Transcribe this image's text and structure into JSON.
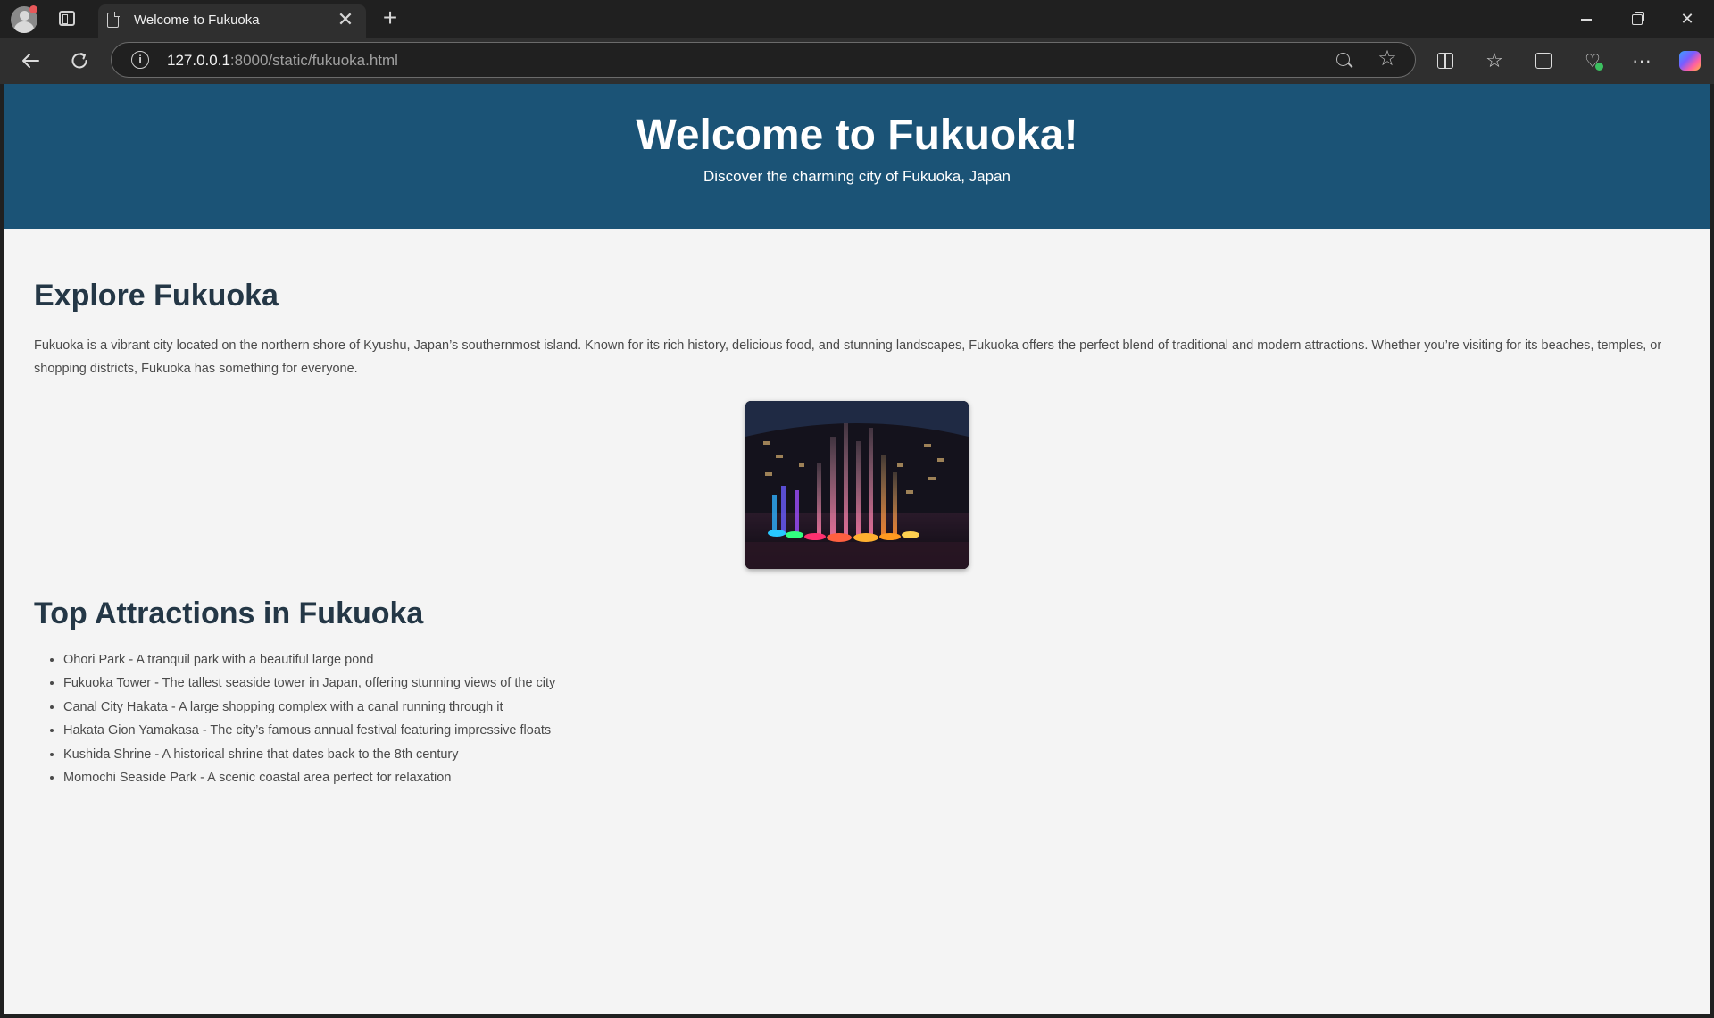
{
  "browser": {
    "tab_title": "Welcome to Fukuoka",
    "tab_close_glyph": "✕",
    "new_tab_glyph": "+",
    "url_host": "127.0.0.1",
    "url_path": ":8000/static/fukuoka.html",
    "icons": {
      "profile": "profile-avatar-icon",
      "tab_actions": "tab-actions-icon",
      "page": "page-icon",
      "back": "back-arrow-icon",
      "reload": "reload-icon",
      "info": "info-icon",
      "zoom": "zoom-out-icon",
      "favorite": "star-icon",
      "split": "split-screen-icon",
      "favorites": "favorites-icon",
      "collections": "collections-icon",
      "health": "browser-essentials-icon",
      "more": "more-icon",
      "copilot": "copilot-icon"
    }
  },
  "page": {
    "hero": {
      "title": "Welcome to Fukuoka!",
      "subtitle": "Discover the charming city of Fukuoka, Japan",
      "background": "#1b5376"
    },
    "explore": {
      "heading": "Explore Fukuoka",
      "text": "Fukuoka is a vibrant city located on the northern shore of Kyushu, Japan’s southernmost island. Known for its rich history, delicious food, and stunning landscapes, Fukuoka offers the perfect blend of traditional and modern attractions. Whether you’re visiting for its beaches, temples, or shopping districts, Fukuoka has something for everyone."
    },
    "photo": {
      "subject": "illuminated fountain show at night"
    },
    "attractions": {
      "heading": "Top Attractions in Fukuoka",
      "items": [
        "Ohori Park - A tranquil park with a beautiful large pond",
        "Fukuoka Tower - The tallest seaside tower in Japan, offering stunning views of the city",
        "Canal City Hakata - A large shopping complex with a canal running through it",
        "Hakata Gion Yamakasa - The city’s famous annual festival featuring impressive floats",
        "Kushida Shrine - A historical shrine that dates back to the 8th century",
        "Momochi Seaside Park - A scenic coastal area perfect for relaxation"
      ]
    },
    "colors": {
      "heading": "#243746",
      "body_text": "#4a4a4a",
      "page_bg": "#f4f4f4"
    }
  }
}
